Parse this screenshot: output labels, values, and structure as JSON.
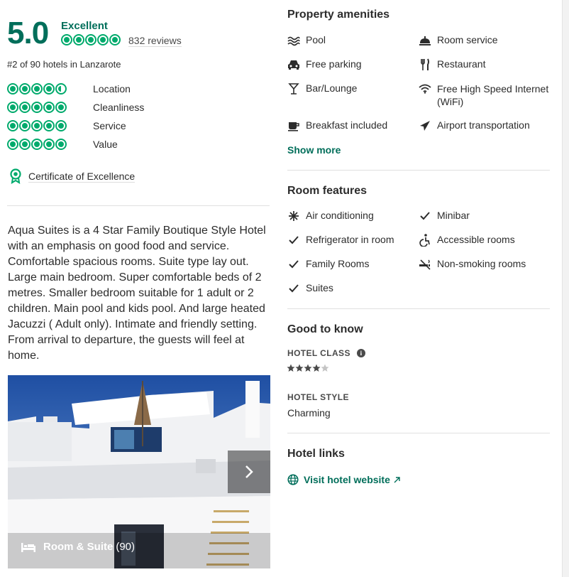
{
  "rating": {
    "score": "5.0",
    "label": "Excellent",
    "reviews": "832 reviews",
    "rank": "#2 of 90 hotels in Lanzarote",
    "bubbles": 5,
    "color": "#00aa6c"
  },
  "sub_ratings": [
    {
      "label": "Location",
      "value": 4.5
    },
    {
      "label": "Cleanliness",
      "value": 5
    },
    {
      "label": "Service",
      "value": 5
    },
    {
      "label": "Value",
      "value": 5
    }
  ],
  "certificate": {
    "label": "Certificate of Excellence",
    "icon": "award-icon"
  },
  "description": "Aqua Suites is a 4 Star Family Boutique Style Hotel with an emphasis on good food and service. Comfortable spacious rooms. Suite type lay out. Large main bedroom. Super comfortable beds of 2 metres. Smaller bedroom suitable for 1 adult or 2 children. Main pool and kids pool. And large heated Jacuzzi ( Adult only). Intimate and friendly setting. From arrival to departure, the guests will feel at home.",
  "photo": {
    "caption_label": "Room & Suite",
    "caption_count": "(90)",
    "next_icon": "chevron-right-icon"
  },
  "amenities": {
    "title": "Property amenities",
    "items": [
      {
        "label": "Pool",
        "icon": "pool-icon"
      },
      {
        "label": "Room service",
        "icon": "room-service-icon"
      },
      {
        "label": "Free parking",
        "icon": "car-icon"
      },
      {
        "label": "Restaurant",
        "icon": "restaurant-icon"
      },
      {
        "label": "Bar/Lounge",
        "icon": "cocktail-icon"
      },
      {
        "label": "Free High Speed Internet (WiFi)",
        "icon": "wifi-icon"
      },
      {
        "label": "Breakfast included",
        "icon": "coffee-icon"
      },
      {
        "label": "Airport transportation",
        "icon": "plane-icon"
      }
    ],
    "show_more": "Show more"
  },
  "room_features": {
    "title": "Room features",
    "items": [
      {
        "label": "Air conditioning",
        "icon": "snowflake-icon"
      },
      {
        "label": "Minibar",
        "icon": "check-icon"
      },
      {
        "label": "Refrigerator in room",
        "icon": "check-icon"
      },
      {
        "label": "Accessible rooms",
        "icon": "wheelchair-icon"
      },
      {
        "label": "Family Rooms",
        "icon": "check-icon"
      },
      {
        "label": "Non-smoking rooms",
        "icon": "no-smoking-icon"
      },
      {
        "label": "Suites",
        "icon": "check-icon"
      }
    ]
  },
  "good_to_know": {
    "title": "Good to know",
    "hotel_class_label": "HOTEL CLASS",
    "hotel_class_stars": 4,
    "hotel_style_label": "HOTEL STYLE",
    "hotel_style_value": "Charming"
  },
  "hotel_links": {
    "title": "Hotel links",
    "visit_label": "Visit hotel website",
    "external_icon": "external-link-icon"
  }
}
